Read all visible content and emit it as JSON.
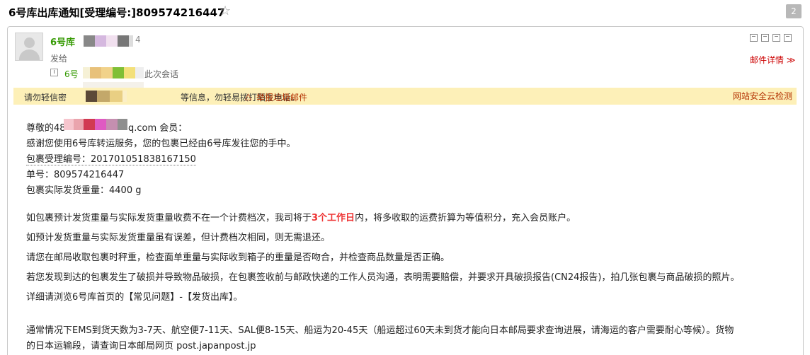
{
  "subject": "6号库出库通知[受理编号:]809574216447",
  "star_icon": "☆",
  "message_count": "2",
  "sender": {
    "name": "6号库",
    "name_suffix": "4",
    "sent_to_label": "发给",
    "conversation_prefix": "6号",
    "conversation_text": "此次会话"
  },
  "toolbar": {
    "icons": [
      "copy-icon",
      "print-icon",
      "share-icon",
      "window-icon"
    ],
    "details_label": "邮件详情 ≫"
  },
  "warning": {
    "text": "请勿轻信密",
    "text_tail": "等信息，勿轻易拨打陌生电话。",
    "report_icon": "△",
    "report_label": "举报垃圾邮件",
    "scan_label": "网站安全云检测"
  },
  "body": {
    "greeting_prefix": "尊敬的48",
    "greeting_suffix": "q.com 会员：",
    "line_thanks": "感谢您使用6号库转运服务，您的包裹已经由6号库发往您的手中。",
    "line_receipt": "包裹受理编号：20170105183816715​0",
    "line_order": "单号：809574216447",
    "line_weight": "包裹实际发货重量：4400 g",
    "para1_prefix": "如包裹预计发货重量与实际发货重量收费不在一个计费档次，我司将于",
    "para1_highlight": "3个工作日",
    "para1_suffix": "内，将多收取的运费折算为等值积分，充入会员账户。",
    "para2": "如预计发货重量与实际发货重量虽有误差，但计费档次相同，则无需退还。",
    "para3": "请您在邮局收取包裹时秤重，检查面单重量与实际收到箱子的重量是否吻合，并检查商品数量是否正确。",
    "para4": "若您发现到达的包裹发生了破损并导致物品破损，在包裹签收前与邮政快递的工作人员沟通，表明需要赔偿，并要求开具破损报告(CN24报告)，拍几张包裹与商品破损的照片。",
    "para5": "详细请浏览6号库首页的【常见问题】-【发货出库】。",
    "para6_line1": "通常情况下EMS到货天数为3-7天、航空便7-11天、SAL便8-15天、船运为20-45天（船运超过60天未到货才能向日本邮局要求查询进展，请海运的客户需要耐心等候）。货物",
    "para6_line2": "的日本运输段，请查询日本邮局网页 post.japanpost.jp"
  }
}
